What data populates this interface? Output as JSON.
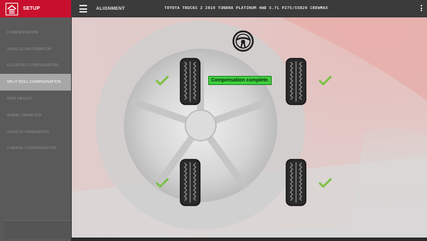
{
  "sidebar": {
    "header_label": "SETUP",
    "items": [
      {
        "label": "COMPENSATION"
      },
      {
        "label": "VEHICLE INFORMATION"
      },
      {
        "label": "ELEVATED COMPENSATION"
      },
      {
        "label": "SPLIT ROLL COMPENSATION"
      },
      {
        "label": "RIDE HEIGHT"
      },
      {
        "label": "WHEEL DIAMETER"
      },
      {
        "label": "VEHICLE DIMENSIONS"
      },
      {
        "label": "2 WHEEL COMPENSATION"
      }
    ],
    "active_item": "SPLIT ROLL COMPENSATION"
  },
  "header": {
    "section_title": "ALIGNMENT",
    "vehicle": "TOYOTA TRUCKS 2 2019 TUNDRA PLATINUM 4WD 5.7L P275/55R20 CREWMAX"
  },
  "main": {
    "status_message": "Compensation complete.",
    "wheels": [
      "front-left",
      "front-right",
      "rear-left",
      "rear-right"
    ]
  },
  "colors": {
    "brand_red": "#c8102e",
    "success_green": "#3fcf3f",
    "check_green": "#7cc043"
  },
  "icons": [
    "home-icon",
    "menu-icon",
    "more-vert-icon",
    "steering-wheel-icon",
    "checkmark-icon",
    "tire-icon"
  ]
}
